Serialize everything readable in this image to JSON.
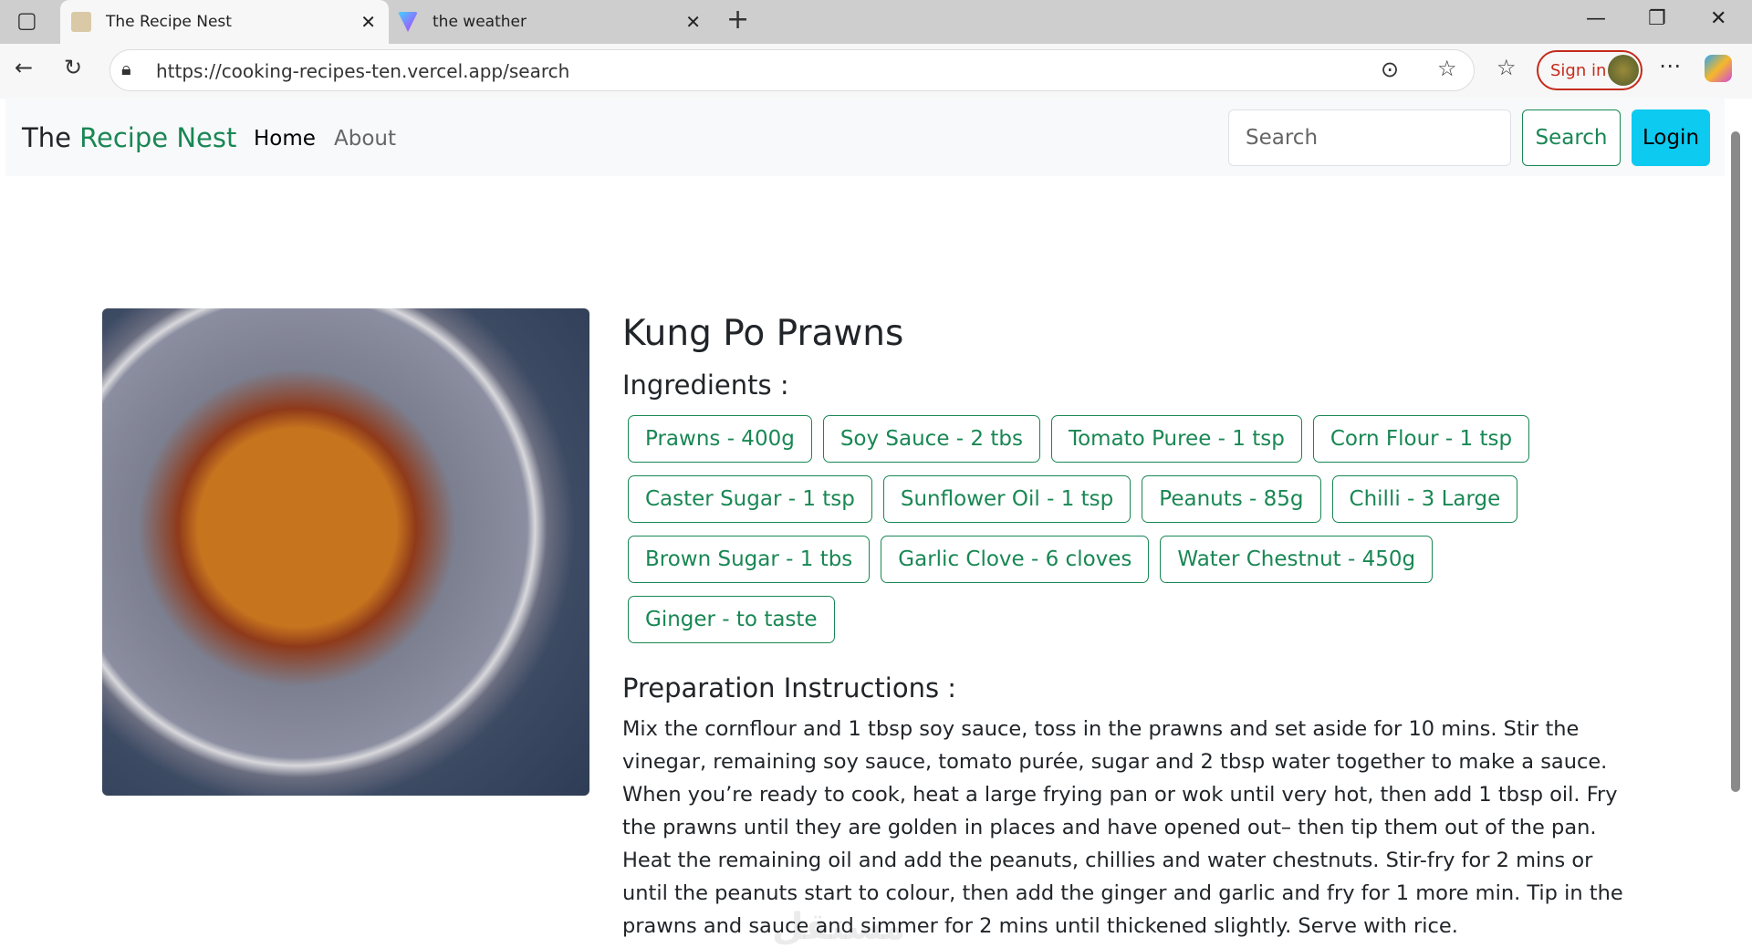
{
  "browser": {
    "tabs": [
      {
        "title": "The Recipe Nest",
        "active": true
      },
      {
        "title": "the weather",
        "active": false
      }
    ],
    "url": "https://cooking-recipes-ten.vercel.app/search",
    "sign_in": "Sign in"
  },
  "navbar": {
    "brand_prefix": "The",
    "brand_highlight": "Recipe Nest",
    "links": [
      "Home",
      "About"
    ],
    "search_placeholder": "Search",
    "search_button": "Search",
    "login_button": "Login"
  },
  "recipe": {
    "title": "Kung Po Prawns",
    "ingredients_heading": "Ingredients :",
    "ingredients": [
      "Prawns - 400g",
      "Soy Sauce - 2 tbs",
      "Tomato Puree - 1 tsp",
      "Corn Flour - 1 tsp",
      "Caster Sugar - 1 tsp",
      "Sunflower Oil - 1 tsp",
      "Peanuts - 85g",
      "Chilli - 3 Large",
      "Brown Sugar - 1 tbs",
      "Garlic Clove - 6 cloves",
      "Water Chestnut - 450g",
      "Ginger - to taste"
    ],
    "instructions_heading": "Preparation Instructions :",
    "instructions": "Mix the cornflour and 1 tbsp soy sauce, toss in the prawns and set aside for 10 mins. Stir the vinegar, remaining soy sauce, tomato purée, sugar and 2 tbsp water together to make a sauce. When you’re ready to cook, heat a large frying pan or wok until very hot, then add 1 tbsp oil. Fry the prawns until they are golden in places and have opened out– then tip them out of the pan. Heat the remaining oil and add the peanuts, chillies and water chestnuts. Stir-fry for 2 mins or until the peanuts start to colour, then add the ginger and garlic and fry for 1 more min. Tip in the prawns and sauce and simmer for 2 mins until thickened slightly. Serve with rice."
  },
  "watermark": "مستقل mostaql.com",
  "colors": {
    "brand": "#198754",
    "login": "#0dcaf0"
  }
}
